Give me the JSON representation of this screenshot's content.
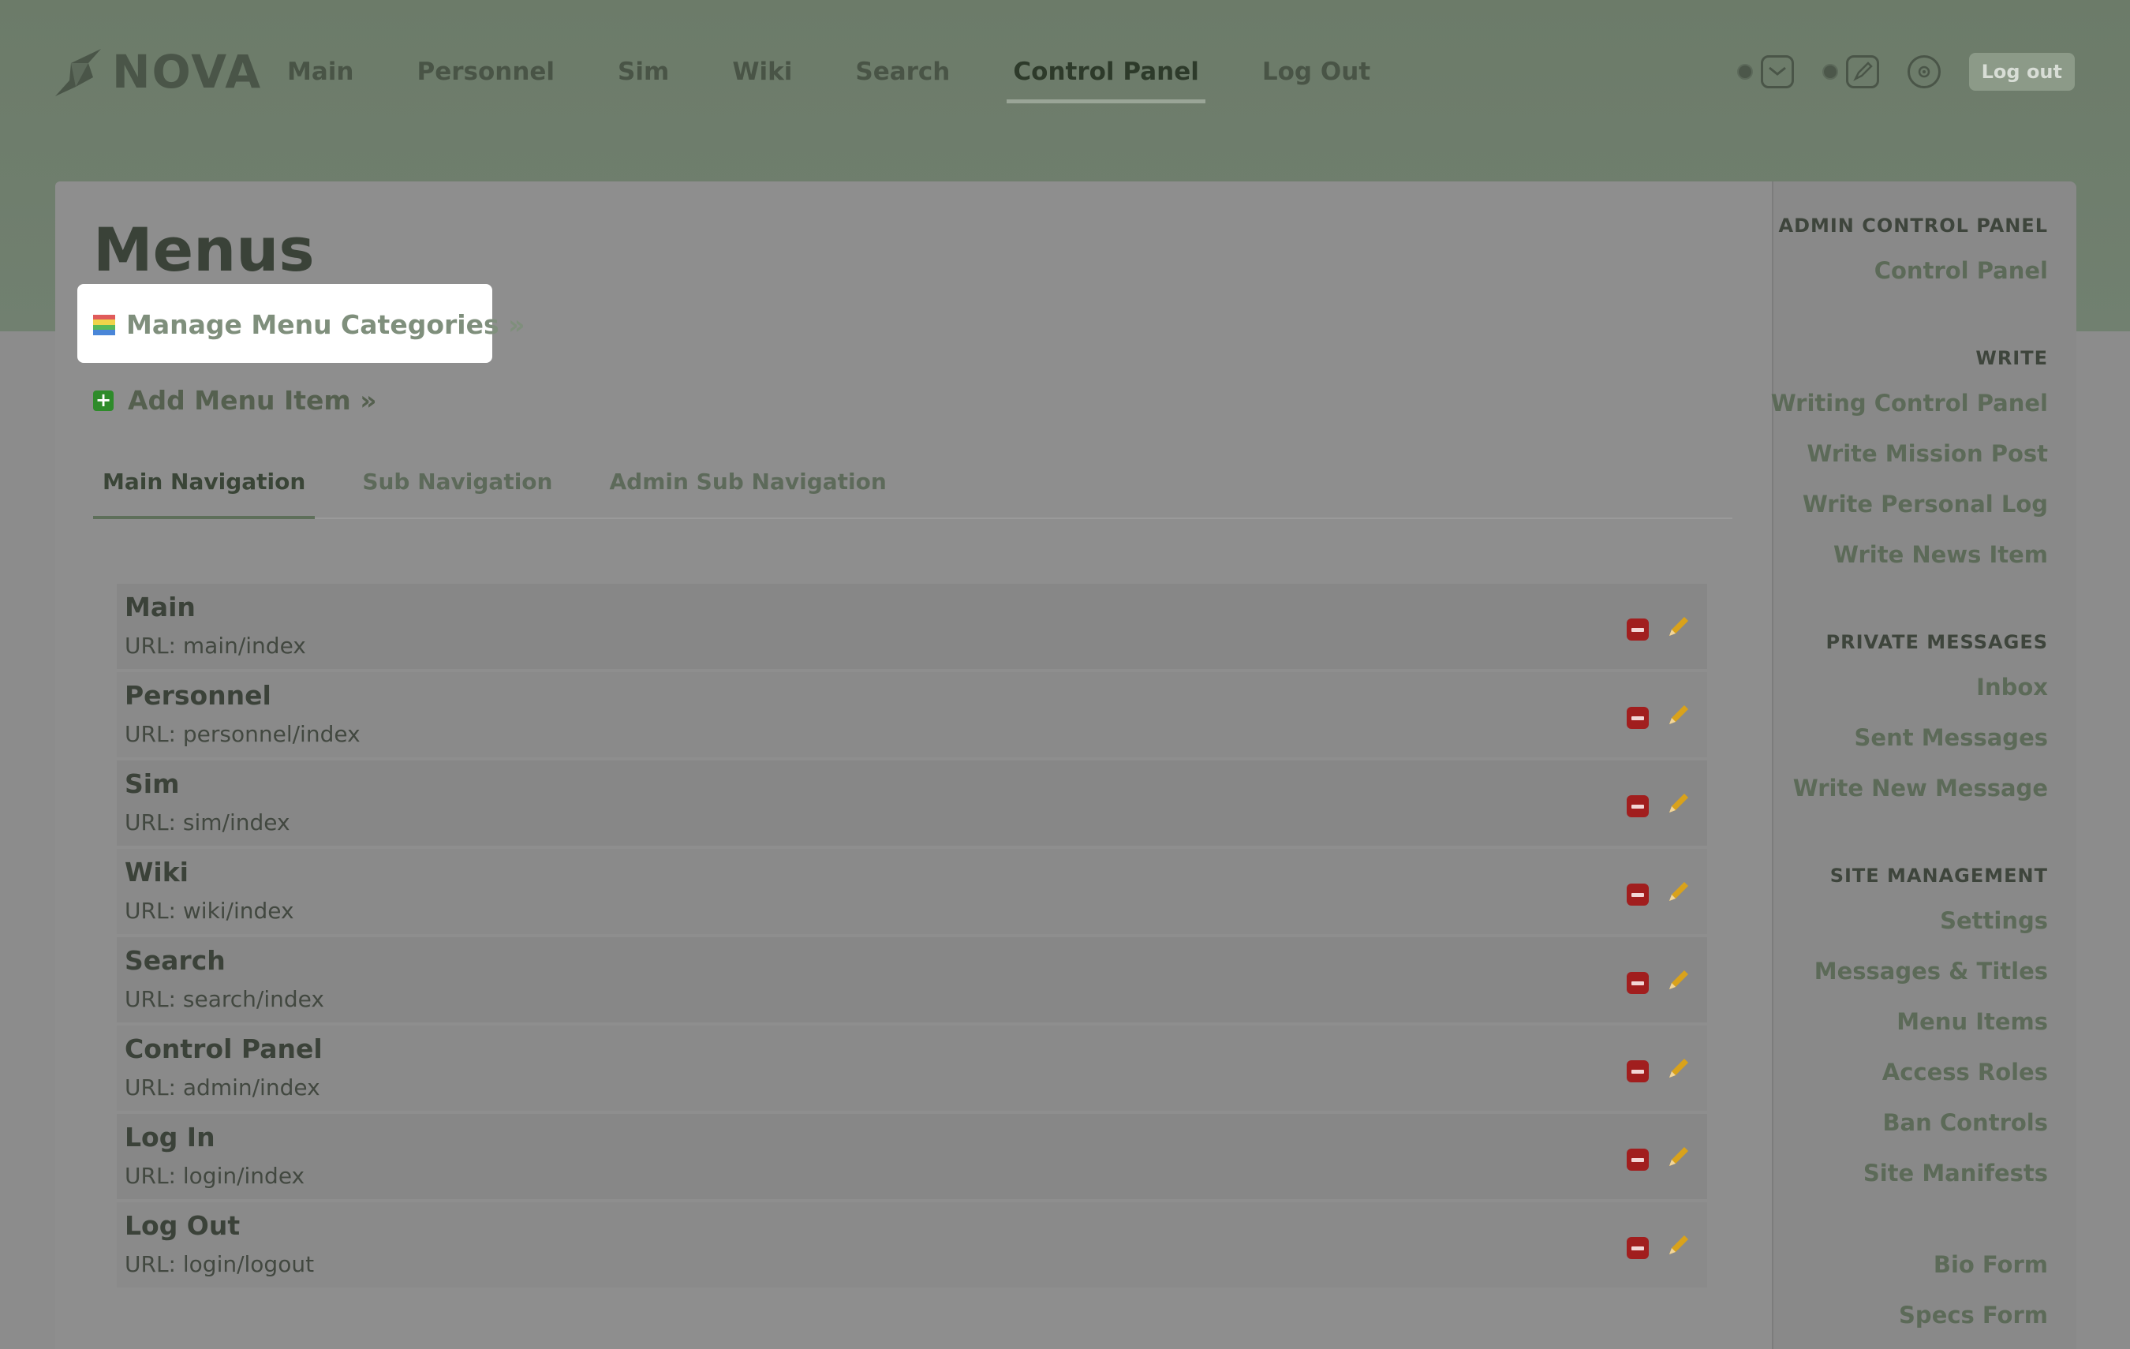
{
  "brand": {
    "name": "NOVA"
  },
  "topnav": [
    {
      "label": "Main"
    },
    {
      "label": "Personnel"
    },
    {
      "label": "Sim"
    },
    {
      "label": "Wiki"
    },
    {
      "label": "Search"
    },
    {
      "label": "Control Panel",
      "active": true
    },
    {
      "label": "Log Out"
    }
  ],
  "header": {
    "logout_label": "Log out",
    "icons": [
      "mail-icon",
      "pen-icon",
      "radar-icon"
    ]
  },
  "page": {
    "title": "Menus",
    "manage_categories": "Manage Menu Categories »",
    "add_item": "Add Menu Item »"
  },
  "tabs": [
    {
      "label": "Main Navigation",
      "active": true
    },
    {
      "label": "Sub Navigation"
    },
    {
      "label": "Admin Sub Navigation"
    }
  ],
  "menu_items": [
    {
      "name": "Main",
      "url": "URL: main/index"
    },
    {
      "name": "Personnel",
      "url": "URL: personnel/index"
    },
    {
      "name": "Sim",
      "url": "URL: sim/index"
    },
    {
      "name": "Wiki",
      "url": "URL: wiki/index"
    },
    {
      "name": "Search",
      "url": "URL: search/index"
    },
    {
      "name": "Control Panel",
      "url": "URL: admin/index"
    },
    {
      "name": "Log In",
      "url": "URL: login/index"
    },
    {
      "name": "Log Out",
      "url": "URL: login/logout"
    }
  ],
  "sidebar": {
    "admin_title": "ADMIN CONTROL PANEL",
    "control_panel": "Control Panel",
    "write_title": "WRITE",
    "write_items": [
      "Writing Control Panel",
      "Write Mission Post",
      "Write Personal Log",
      "Write News Item"
    ],
    "pm_title": "PRIVATE MESSAGES",
    "pm_items": [
      "Inbox",
      "Sent Messages",
      "Write New Message"
    ],
    "site_title": "SITE MANAGEMENT",
    "site_items": [
      "Settings",
      "Messages & Titles",
      "Menu Items",
      "Access Roles",
      "Ban Controls",
      "Site Manifests"
    ],
    "form_items": [
      "Bio Form",
      "Specs Form"
    ]
  },
  "colors": {
    "accent": "#7f8f7c",
    "delete": "#a11e1e",
    "add": "#2e8b2a"
  }
}
